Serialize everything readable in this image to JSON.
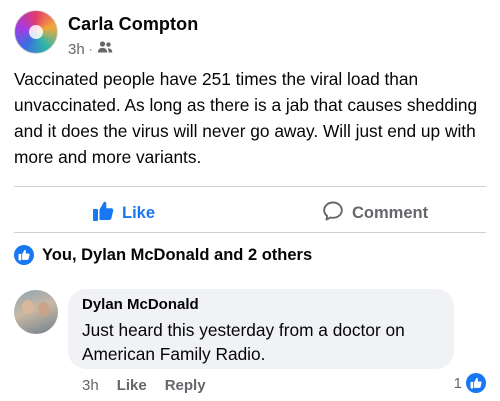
{
  "post": {
    "author": "Carla Compton",
    "time": "3h",
    "separator": "·",
    "audience_icon": "friends-icon",
    "text": "Vaccinated people have 251 times the viral load than unvaccinated. As long as there is a jab that causes shedding and it does the virus will never go away. Will just end up with more and more variants."
  },
  "actions": {
    "like_label": "Like",
    "comment_label": "Comment"
  },
  "reactions": {
    "summary": "You, Dylan McDonald and 2 others"
  },
  "comment": {
    "author": "Dylan McDonald",
    "text": "Just heard this yesterday from a doctor on American Family Radio.",
    "time": "3h",
    "like_label": "Like",
    "reply_label": "Reply",
    "reaction_count": "1"
  },
  "colors": {
    "accent": "#1877f2",
    "muted": "#65676b",
    "bubble": "#f0f2f5"
  }
}
